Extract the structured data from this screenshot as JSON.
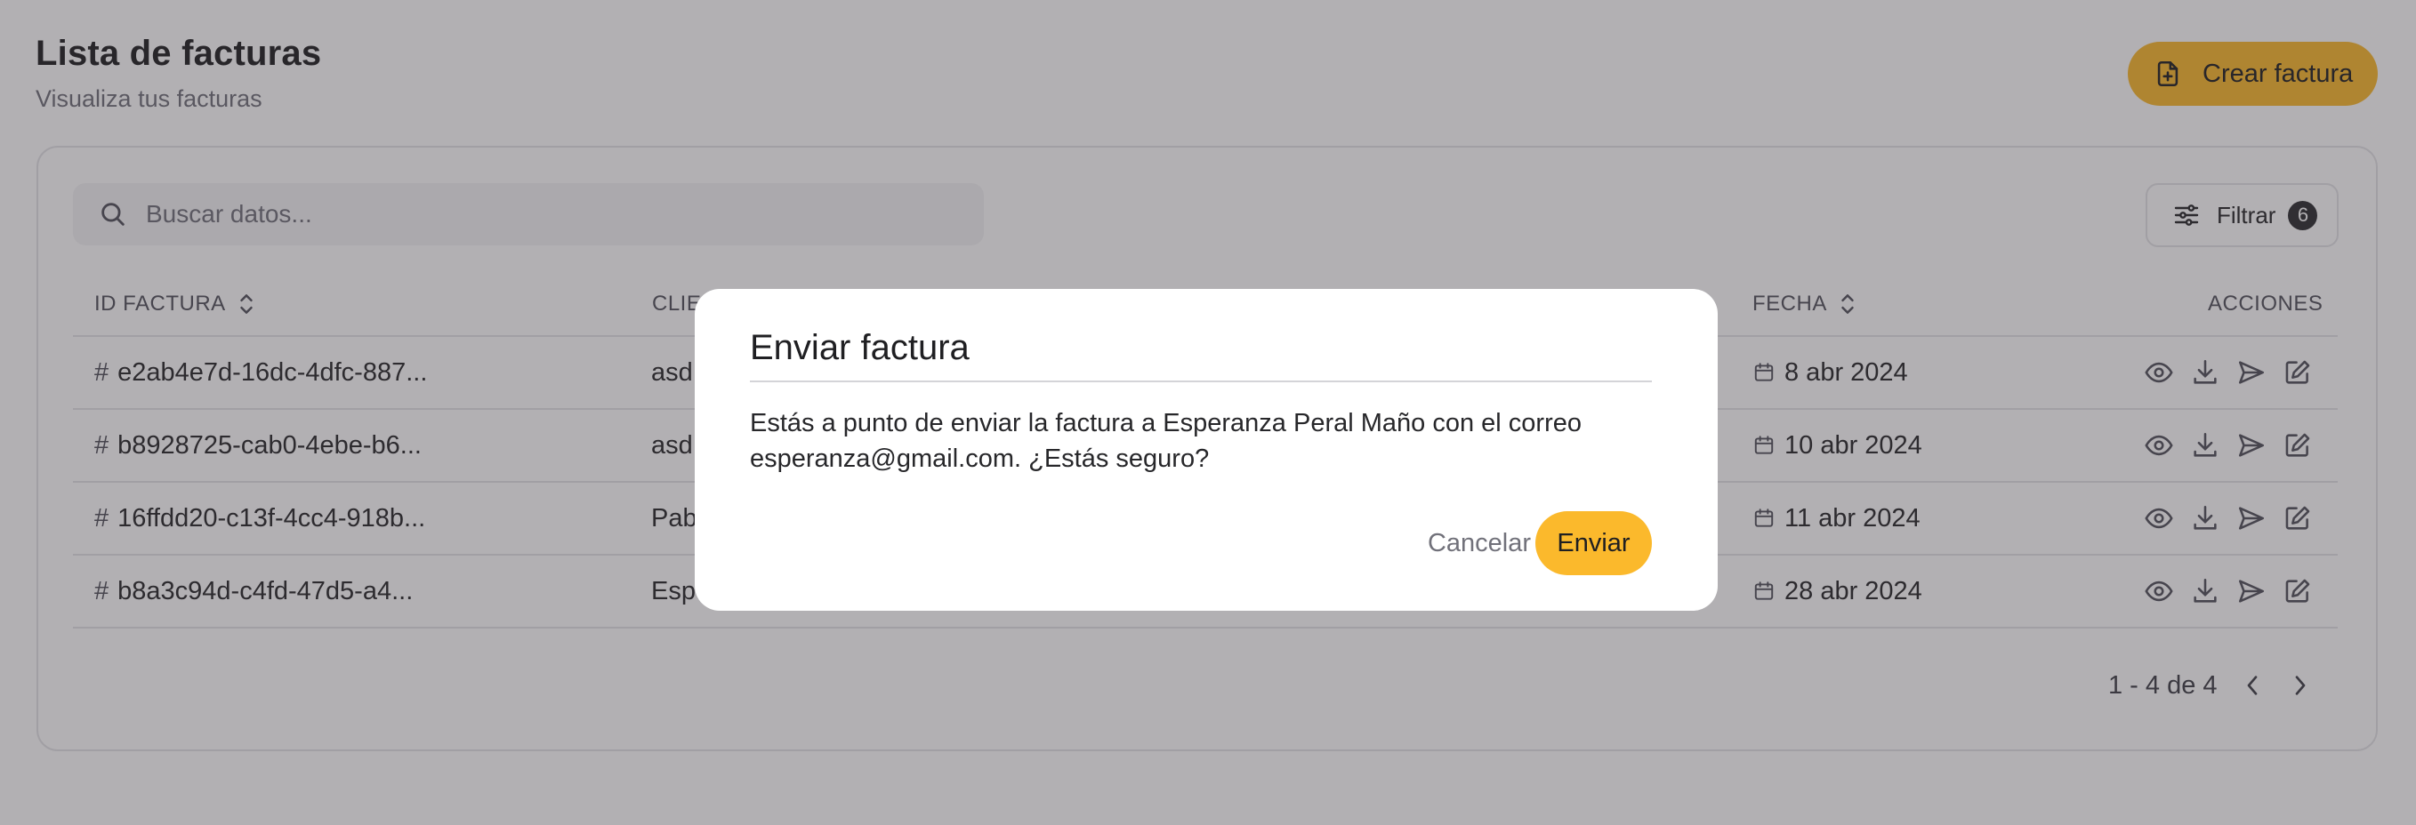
{
  "header": {
    "title": "Lista de facturas",
    "subtitle": "Visualiza tus facturas",
    "create_button_label": "Crear factura"
  },
  "toolbar": {
    "search_placeholder": "Buscar datos...",
    "filter_label": "Filtrar",
    "filter_count": "6"
  },
  "table": {
    "columns": {
      "id": "ID FACTURA",
      "client": "CLIE",
      "date": "FECHA",
      "actions": "ACCIONES"
    },
    "rows": [
      {
        "id": "e2ab4e7d-16dc-4dfc-887...",
        "client": "asd",
        "date": "8 abr 2024"
      },
      {
        "id": "b8928725-cab0-4ebe-b6...",
        "client": "asd",
        "date": "10 abr 2024"
      },
      {
        "id": "16ffdd20-c13f-4cc4-918b...",
        "client": "Pab",
        "date": "11 abr 2024"
      },
      {
        "id": "b8a3c94d-c4fd-47d5-a4...",
        "client": "Esp",
        "date": "28 abr 2024"
      }
    ],
    "row_actions": [
      "eye-icon",
      "download-icon",
      "send-icon",
      "edit-icon"
    ]
  },
  "pagination": {
    "summary": "1 - 4 de 4"
  },
  "modal": {
    "title": "Enviar factura",
    "message": "Estás a punto de enviar la factura a Esperanza Peral Maño con el correo esperanza@gmail.com. ¿Estás seguro?",
    "cancel_label": "Cancelar",
    "confirm_label": "Enviar"
  },
  "colors": {
    "accent": "#fbb92c",
    "overlay": "rgba(55, 50, 58, 0.385)",
    "border": "#e4e4e7",
    "text": "#27272a",
    "muted": "#71717a"
  }
}
